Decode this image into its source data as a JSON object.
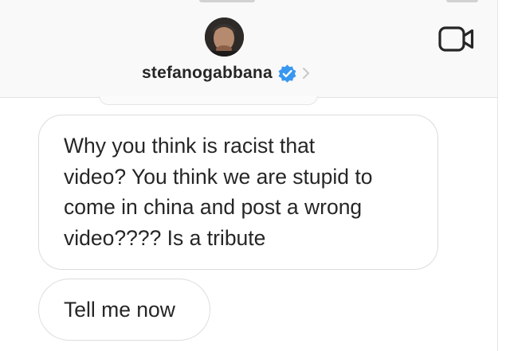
{
  "header": {
    "username": "stefanogabbana",
    "verified": true,
    "avatar": "profile-photo",
    "icons": {
      "verified": "verified-badge-icon",
      "chevron": "chevron-right-icon",
      "video_call": "video-camera-icon"
    },
    "colors": {
      "verified": "#3897f0",
      "text": "#262626",
      "chevron": "#c7c7c7"
    }
  },
  "messages": [
    {
      "sender": "other",
      "lines": [
        "Why you think is racist that",
        "video? You think we are stupid to",
        "come in china and post a wrong",
        "video???? Is a tribute"
      ]
    },
    {
      "sender": "other",
      "lines": [
        "Tell me now"
      ]
    }
  ]
}
